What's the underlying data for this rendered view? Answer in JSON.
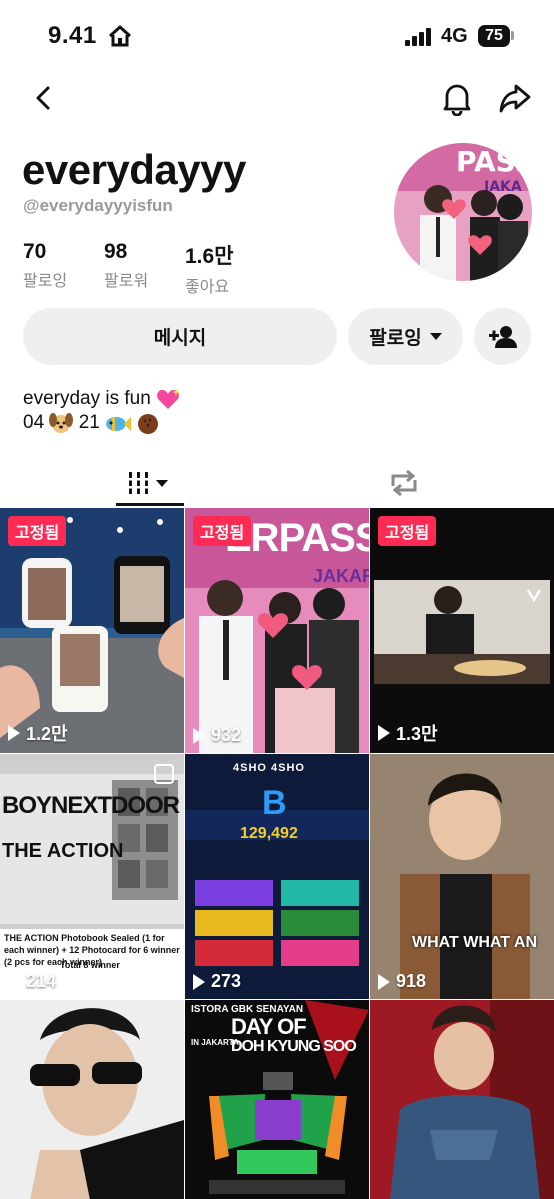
{
  "status_bar": {
    "time": "9.41",
    "network": "4G",
    "battery": "75"
  },
  "profile": {
    "username": "everydayyy",
    "handle": "@everydayyyisfun",
    "stats": [
      {
        "value": "70",
        "label": "팔로잉"
      },
      {
        "value": "98",
        "label": "팔로워"
      },
      {
        "value": "1.6만",
        "label": "좋아요"
      }
    ],
    "bio_line1": "everyday is fun",
    "bio_line2_a": "04",
    "bio_line2_b": "21"
  },
  "buttons": {
    "message": "메시지",
    "following": "팔로잉"
  },
  "videos": [
    {
      "pinned_label": "고정됨",
      "views": "1.2만"
    },
    {
      "pinned_label": "고정됨",
      "views": "932",
      "overlay": "ERPASS",
      "overlay2": "JAKARTA"
    },
    {
      "pinned_label": "고정됨",
      "views": "1.3만"
    },
    {
      "views": "214",
      "overlay": "BOYNEXTDOOR",
      "overlay2": "THE ACTION",
      "caption": "THE ACTION Photobook Sealed (1 for each winner) + 12 Photocard for 6 winner (2 pcs for each winner)",
      "caption2": "Total 8 winner"
    },
    {
      "views": "273",
      "overlay": "4SHO 4SHO",
      "overlay2": "B",
      "score": "129,492"
    },
    {
      "views": "918",
      "overlay": "WHAT WHAT AN"
    },
    {
      "overlay": "ISTORA GBK SENAYAN",
      "overlay2": "DAY OF",
      "overlay3": "DOH KYUNG SOO",
      "overlay4": "IN JAKARTA"
    }
  ],
  "colors": {
    "pin": "#fe2c55",
    "button_bg": "#efefef",
    "muted": "#8a8a8a"
  }
}
